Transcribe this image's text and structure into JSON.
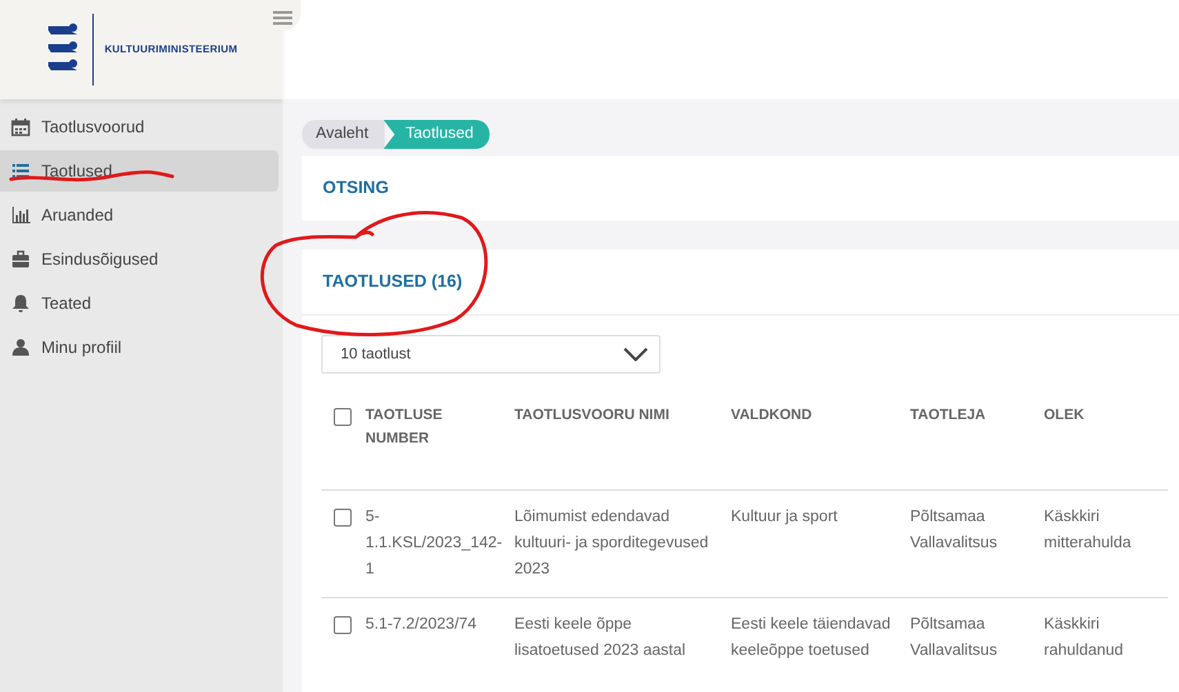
{
  "logo": {
    "text": "KULTUURIMINISTEERIUM"
  },
  "sidebar": {
    "items": [
      {
        "label": "Taotlusvoorud",
        "selected": false
      },
      {
        "label": "Taotlused",
        "selected": true
      },
      {
        "label": "Aruanded",
        "selected": false
      },
      {
        "label": "Esindusõigused",
        "selected": false
      },
      {
        "label": "Teated",
        "selected": false
      },
      {
        "label": "Minu profiil",
        "selected": false
      }
    ]
  },
  "breadcrumb": [
    {
      "label": "Avaleht",
      "selected": false
    },
    {
      "label": "Taotlused",
      "selected": true
    }
  ],
  "search_panel": {
    "title": "OTSING"
  },
  "list_panel": {
    "title": "TAOTLUSED (16)",
    "page_size": "10 taotlust",
    "table": {
      "columns": [
        "TAOTLUSE NUMBER",
        "TAOTLUSVOORU NIMI",
        "VALDKOND",
        "TAOTLEJA",
        "OLEK"
      ],
      "header_checked": false,
      "rows": [
        {
          "checked": false,
          "cells": [
            "5-1.1.KSL/2023_142-1",
            "Lõimumist edendavad kultuuri- ja sporditegevused 2023",
            "Kultuur ja sport",
            "Põltsamaa Vallavalitsus",
            "Käskkiri mitterahulda"
          ]
        },
        {
          "checked": false,
          "cells": [
            "5.1-7.2/2023/74",
            "Eesti keele õppe lisatoetused 2023 aastal",
            "Eesti keele täiendavad keeleõppe toetused",
            "Põltsamaa Vallavalitsus",
            "Käskkiri rahuldanud"
          ]
        }
      ]
    }
  }
}
